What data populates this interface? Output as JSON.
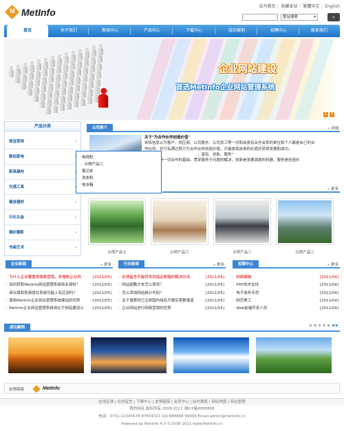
{
  "header": {
    "logo_text": "MetInfo",
    "top_links": [
      "设为首页",
      "收藏本站",
      "繁體中文",
      "English"
    ],
    "search": {
      "input_value": "",
      "select_value": "整站搜索"
    }
  },
  "nav": [
    "首页",
    "关于我们",
    "新闻中心",
    "产品中心",
    "下载中心",
    "成功案例",
    "招聘中心",
    "联系我们"
  ],
  "banner": {
    "line1": "企业网站建设",
    "line2": "首选MetInfo企业网站管理系统",
    "pages": [
      "1",
      "2"
    ]
  },
  "sidebar": {
    "title": "产品分类",
    "categories": [
      "珠宝首饰",
      "数码家电",
      "家具建材",
      "交通工具",
      "健身器材",
      "日化五金",
      "婚纱摄影",
      "书画艺术"
    ]
  },
  "popup": [
    "电视机",
    "· 示例产品二",
    "笔记本",
    "洗衣机",
    "电冰箱"
  ],
  "intro": {
    "tab": "公司简介",
    "more": "详细",
    "heading": "关于\"为合作伙伴创造价值\"",
    "lines": [
      "米拓信息认为客户、供应商、公司股东、公司员工等一切和自身有合作关系的单位和个人都是自己的合",
      "作伙伴，并只有通过努力为合作伙伴创造价值，才能体现自身的价值并获得发展和成功。",
      "　　　　　　　　　　　　　　，富有、创新、服务\"",
      "认为诚信是一切合作的基础，贯穿服务于问题的解决，创新是发展源泉的利器，服务是创造价"
    ]
  },
  "products": {
    "more": "更多",
    "captions": [
      "示例产品七",
      "示例产品六",
      "示例产品三",
      "示例产品二"
    ]
  },
  "news_corp": {
    "tab": "企业新闻",
    "more": "更多",
    "items": [
      {
        "t": "为什么企业要重视搜索营销，多搜帐企业网",
        "d": "[2011/05]",
        "hot": true
      },
      {
        "t": "如何获取MetInfo网站管理系统商业授权？",
        "d": "[2011/05]"
      },
      {
        "t": "商业版和免费版在系统功能上有区别吗？",
        "d": "[2011/05]"
      },
      {
        "t": "使用MetInfo企业网站管理系统建站的优势",
        "d": "[2011/05]"
      },
      {
        "t": "MetInfo企业网站管理系统用比于网站建设公",
        "d": "[2011/05]"
      }
    ]
  },
  "news_ind": {
    "tab": "行业新闻",
    "more": "更多",
    "items": [
      {
        "t": "反馈留言不能转发到指定邮箱的解决办法",
        "d": "[2011/05]",
        "hot": true
      },
      {
        "t": "网站超酷文本怎么修改？",
        "d": "[2011/05]"
      },
      {
        "t": "怎么添加网站统计代码？",
        "d": "[2011/05]"
      },
      {
        "t": "关于搜索时已注册国内域名开展实表数报道",
        "d": "[2011/05]"
      },
      {
        "t": "企业网站进行网络营销的优势",
        "d": "[2011/05]"
      }
    ]
  },
  "jobs": {
    "tab": "招聘中心",
    "more": "更多",
    "items": [
      {
        "t": "网络编辑",
        "d": "[2011/04]",
        "hot": true
      },
      {
        "t": "PHP技术支持",
        "d": "[2011/04]"
      },
      {
        "t": "电子商务专员",
        "d": "[2011/04]"
      },
      {
        "t": "网页美工",
        "d": "[2011/04]"
      },
      {
        "t": "Web前端开发人员",
        "d": "[2011/04]"
      }
    ]
  },
  "cases": {
    "tab": "成功案例"
  },
  "friend_links": {
    "label": "友情链接",
    "logo": "MetInfo"
  },
  "footer": {
    "links": "在线反馈 | 在线留言 | 下载中心 | 友情链接 | 会员中心 | 站内搜索 | 网站地图 | 网站管理",
    "copyright": "我的网站 版权所有 2008-2011 湘ICP备8888888",
    "contact": "电话：0731-12345678 87654321 QQ:888888 99999 Email:admin@metinfo.cn",
    "powered": "Powered by MetInfo 4.0 ©2008-2011 www.MetInfo.cn"
  }
}
